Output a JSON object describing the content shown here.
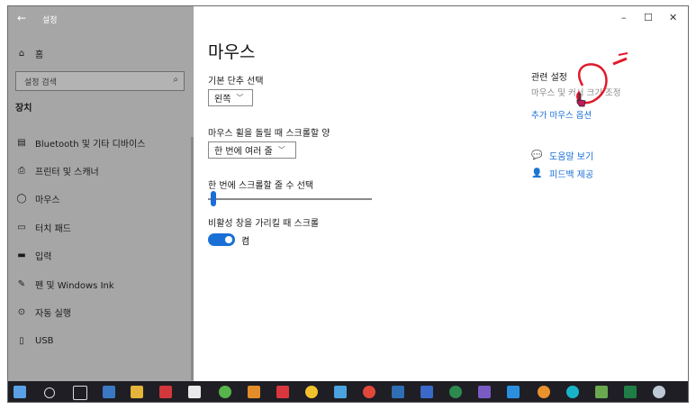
{
  "window": {
    "title": "설정",
    "back_icon": "←",
    "min": "–",
    "max": "☐",
    "close": "✕"
  },
  "sidebar": {
    "home_label": "홈",
    "search_placeholder": "설정 검색",
    "section_title": "장치",
    "items": [
      {
        "label": "Bluetooth 및 기타 디바이스",
        "icon": "bluetooth-devices-icon"
      },
      {
        "label": "프린터 및 스캐너",
        "icon": "printer-icon"
      },
      {
        "label": "마우스",
        "icon": "mouse-icon"
      },
      {
        "label": "터치 패드",
        "icon": "touchpad-icon"
      },
      {
        "label": "입력",
        "icon": "keyboard-icon"
      },
      {
        "label": "펜 및 Windows Ink",
        "icon": "pen-icon"
      },
      {
        "label": "자동 실행",
        "icon": "autoplay-icon"
      },
      {
        "label": "USB",
        "icon": "usb-icon"
      }
    ]
  },
  "main": {
    "title": "마우스",
    "primary_button_label": "기본 단추 선택",
    "primary_button_value": "왼쪽",
    "scroll_label": "마우스 휠을 돌릴 때 스크롤할 양",
    "scroll_value": "한 번에 여러 줄",
    "lines_label": "한 번에 스크롤할 줄 수 선택",
    "lines_value": 0.03,
    "inactive_scroll_label": "비활성 창을 가리킬 때 스크롤",
    "inactive_scroll_state": "켬"
  },
  "related": {
    "heading": "관련 설정",
    "link1": "마우스 및 커서 크기 조정",
    "link2": "추가 마우스 옵션",
    "help": "도움말 보기",
    "feedback": "피드백 제공"
  },
  "colors": {
    "accent": "#1a6fd6",
    "sidebar_bg": "#a6a6a6",
    "taskbar_bg": "#1e1e24"
  },
  "taskbar": {
    "icons": [
      "windows-start-icon",
      "search-icon",
      "task-view-icon",
      "calculator-icon",
      "file-explorer-icon",
      "app-icon",
      "terminal-icon",
      "torrent-icon",
      "app-icon",
      "app-icon",
      "media-player-icon",
      "app-icon",
      "chrome-icon",
      "app-icon",
      "app-icon",
      "app-icon",
      "app-icon",
      "vscode-icon",
      "app-icon",
      "app-icon",
      "app-icon",
      "excel-icon",
      "app-icon"
    ]
  }
}
